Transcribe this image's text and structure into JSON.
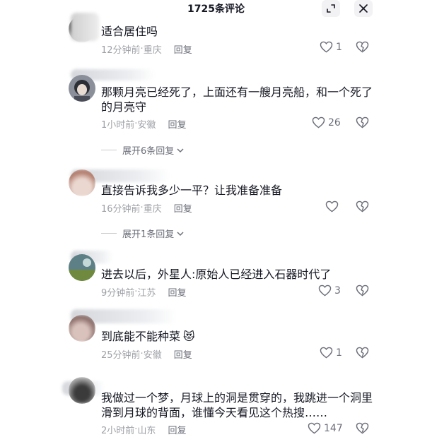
{
  "header": {
    "title": "1725条评论"
  },
  "comments": [
    {
      "text": "适合居住吗",
      "time": "12分钟前",
      "location": "重庆",
      "reply": "回复",
      "likes": "1"
    },
    {
      "text": "那颗月亮已经死了，上面还有一艘月亮船，和一个死了的月亮守",
      "time": "1小时前",
      "location": "安徽",
      "reply": "回复",
      "likes": "26",
      "expand": "展开6条回复"
    },
    {
      "text": "直接告诉我多少一平？让我准备准备",
      "time": "16分钟前",
      "location": "重庆",
      "reply": "回复",
      "likes": "",
      "expand": "展开1条回复"
    },
    {
      "text": "进去以后，外星人:原始人已经进入石器时代了",
      "time": "9分钟前",
      "location": "江苏",
      "reply": "回复",
      "likes": "3"
    },
    {
      "text": "到底能不能种菜",
      "emoji": "😻",
      "time": "25分钟前",
      "location": "安徽",
      "reply": "回复",
      "likes": "1"
    },
    {
      "text": "我做过一个梦，月球上的洞是贯穿的，我跳进一个洞里滑到月球的背面，谁懂今天看见这个热搜……",
      "time": "2小时前",
      "location": "山东",
      "reply": "回复",
      "likes": "147"
    }
  ],
  "meta_separator": "·",
  "colors": {
    "text": "#161823",
    "meta": "#9fa1a7",
    "icon": "#6b6e78",
    "header_btn_bg": "#f2f2f4"
  },
  "icons": {
    "minimize": "shrink-icon",
    "close": "close-icon",
    "like": "heart-outline-icon",
    "dislike": "broken-heart-icon",
    "expand": "chevron-down-icon"
  }
}
